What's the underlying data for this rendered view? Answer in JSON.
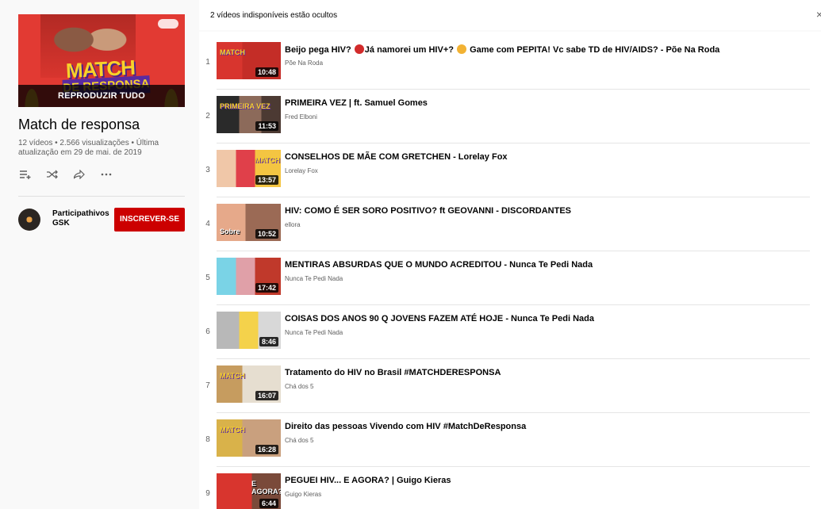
{
  "playlist": {
    "thumb_text": "MATCH",
    "thumb_subtext": "DE RESPONSA",
    "play_all": "REPRODUZIR TUDO",
    "title": "Match de responsa",
    "stats": "12 vídeos • 2.566 visualizações • Última atualização em 29 de mai. de 2019",
    "owner_name": "Participathivos GSK",
    "subscribe_label": "INSCREVER-SE"
  },
  "notice": {
    "text": "2 vídeos indisponíveis estão ocultos",
    "close": "×"
  },
  "videos": [
    {
      "index": "1",
      "title_a": "Beijo pega HIV? ",
      "title_b": "Já namorei um HIV+? ",
      "title_c": " Game com PEPITA! Vc sabe TD de HIV/AIDS? - Põe Na Roda",
      "channel": "Põe Na Roda",
      "duration": "10:48",
      "thumb_label": "MATCH"
    },
    {
      "index": "2",
      "title": "PRIMEIRA VEZ | ft. Samuel Gomes",
      "channel": "Fred Elboni",
      "duration": "11:53",
      "thumb_label": "PRIMEIRA VEZ"
    },
    {
      "index": "3",
      "title": "CONSELHOS DE MÃE COM GRETCHEN - Lorelay Fox",
      "channel": "Lorelay Fox",
      "duration": "13:57",
      "thumb_label": "MATCH"
    },
    {
      "index": "4",
      "title": "HIV: COMO É SER SORO POSITIVO? ft GEOVANNI - DISCORDANTES",
      "channel": "ellora",
      "duration": "10:52",
      "thumb_label": "Sobre"
    },
    {
      "index": "5",
      "title": "MENTIRAS ABSURDAS QUE O MUNDO ACREDITOU - Nunca Te Pedi Nada",
      "channel": "Nunca Te Pedi Nada",
      "duration": "17:42",
      "thumb_label": ""
    },
    {
      "index": "6",
      "title": "COISAS DOS ANOS 90 Q JOVENS FAZEM ATÉ HOJE - Nunca Te Pedi Nada",
      "channel": "Nunca Te Pedi Nada",
      "duration": "8:46",
      "thumb_label": ""
    },
    {
      "index": "7",
      "title": "Tratamento do HIV no Brasil #MATCHDERESPONSA",
      "channel": "Chá dos 5",
      "duration": "16:07",
      "thumb_label": "MATCH"
    },
    {
      "index": "8",
      "title": "Direito das pessoas Vivendo com HIV #MatchDeResponsa",
      "channel": "Chá dos 5",
      "duration": "16:28",
      "thumb_label": "MATCH"
    },
    {
      "index": "9",
      "title": "PEGUEI HIV... E AGORA? | Guigo Kieras",
      "channel": "Guigo Kieras",
      "duration": "6:44",
      "thumb_label": "E AGORA?"
    }
  ],
  "icons": {
    "add_to_queue": "add-to-queue-icon",
    "shuffle": "shuffle-icon",
    "share": "share-icon",
    "more": "more-icon"
  },
  "colors": {
    "subscribe": "#cc0000",
    "thumb_red": "#e23a33",
    "match_yellow": "#f7d22a",
    "match_purple": "#5a2ba0"
  }
}
